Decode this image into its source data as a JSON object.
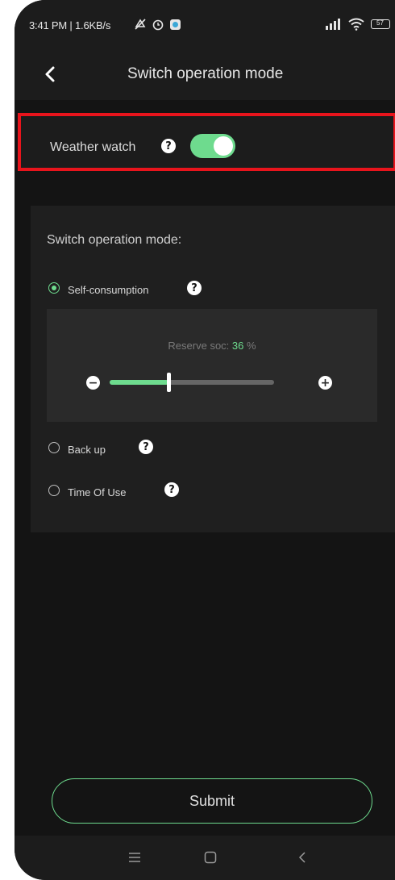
{
  "status_bar": {
    "time_speed": "3:41 PM | 1.6KB/s",
    "battery_level": "57"
  },
  "header": {
    "back_icon": "chevron-left-icon",
    "title": "Switch operation mode"
  },
  "weather_watch": {
    "label": "Weather watch",
    "help": "?",
    "enabled": true
  },
  "mode_section": {
    "heading": "Switch operation mode:",
    "options": [
      {
        "label": "Self-consumption",
        "help": "?",
        "selected": true
      },
      {
        "label": "Back up",
        "help": "?",
        "selected": false
      },
      {
        "label": "Time Of Use",
        "help": "?",
        "selected": false
      }
    ],
    "reserve": {
      "label": "Reserve soc:",
      "value": "36",
      "unit": "%",
      "slider_fraction": 0.36,
      "minus": "−",
      "plus": "+"
    }
  },
  "submit_label": "Submit",
  "colors": {
    "accent": "#6edb8e",
    "highlight_border": "#e8141c",
    "background": "#141414"
  }
}
